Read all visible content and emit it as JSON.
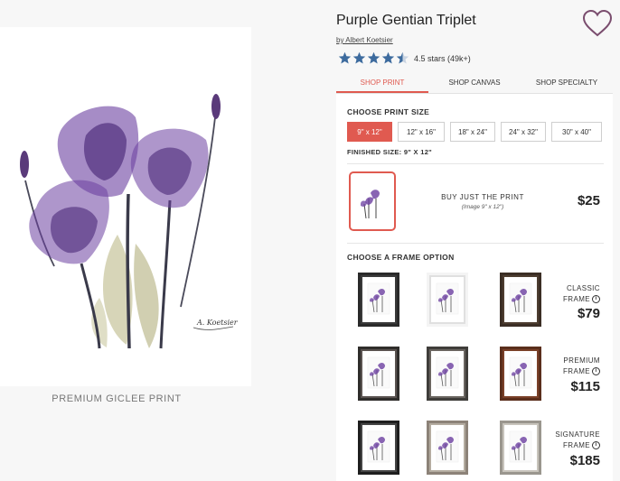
{
  "product": {
    "title": "Purple Gentian Triplet",
    "artist": "by Albert Koetsier",
    "rating": 4.5,
    "rating_text": "4.5 stars (49k+)",
    "caption": "PREMIUM GICLEE PRINT",
    "signature": "A. Koetsier"
  },
  "icons": {
    "favorite": "heart-icon",
    "star": "star-icon",
    "info": "info-icon"
  },
  "colors": {
    "accent": "#e05a50",
    "star": "#3d6b9e",
    "heart": "#7a4d6e",
    "purple": "#6b3fa0"
  },
  "tabs": [
    {
      "label": "SHOP PRINT",
      "active": true
    },
    {
      "label": "SHOP CANVAS",
      "active": false
    },
    {
      "label": "SHOP SPECIALTY",
      "active": false
    }
  ],
  "print_size": {
    "title": "CHOOSE PRINT SIZE",
    "options": [
      {
        "label": "9\" x 12\"",
        "selected": true
      },
      {
        "label": "12\" x 16\"",
        "selected": false
      },
      {
        "label": "18\" x 24\"",
        "selected": false
      },
      {
        "label": "24\" x 32\"",
        "selected": false
      },
      {
        "label": "30\" x 40\"",
        "selected": false
      }
    ],
    "finished": "FINISHED SIZE: 9\" X 12\""
  },
  "buy_print": {
    "label": "BUY JUST THE PRINT",
    "sub": "(Image 9\" x 12\")",
    "price": "$25"
  },
  "frame_section": {
    "title": "CHOOSE A FRAME OPTION",
    "groups": [
      {
        "line1": "CLASSIC",
        "line2": "FRAME",
        "price": "$79"
      },
      {
        "line1": "PREMIUM",
        "line2": "FRAME",
        "price": "$115"
      },
      {
        "line1": "SIGNATURE",
        "line2": "FRAME",
        "price": "$185"
      }
    ],
    "info_glyph": "i"
  }
}
